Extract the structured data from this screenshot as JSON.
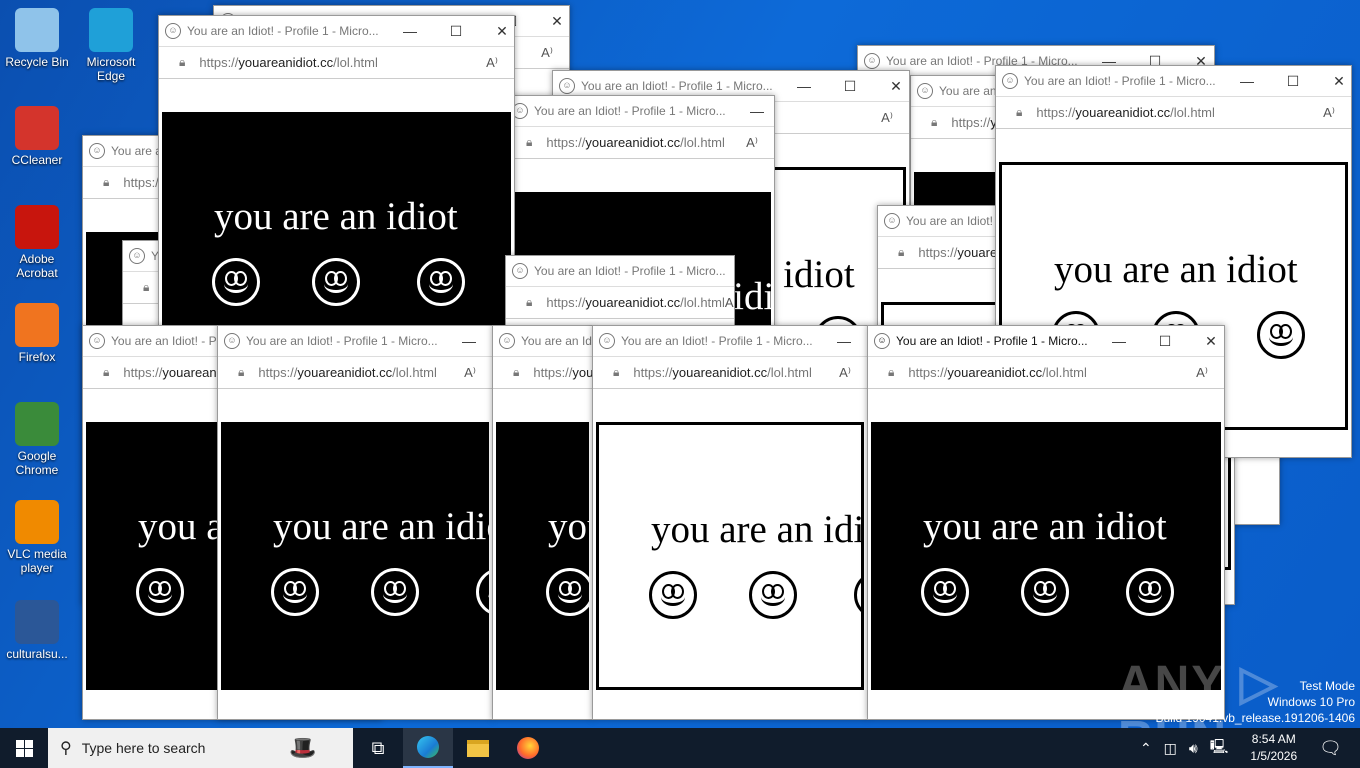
{
  "desktop": {
    "icons": [
      {
        "label": "Recycle Bin",
        "icon": "recycle-bin-icon",
        "color": "#8fc3ea"
      },
      {
        "label": "Microsoft Edge",
        "icon": "edge-icon",
        "color": "#1fa0d8"
      },
      {
        "label": "CCleaner",
        "icon": "ccleaner-icon",
        "color": "#d4342c"
      },
      {
        "label": "Adobe Acrobat",
        "icon": "acrobat-icon",
        "color": "#c8150d"
      },
      {
        "label": "Firefox",
        "icon": "firefox-icon",
        "color": "#f0741f"
      },
      {
        "label": "Google Chrome",
        "icon": "chrome-icon",
        "color": "#3a8b3a"
      },
      {
        "label": "VLC media player",
        "icon": "vlc-icon",
        "color": "#f08a00"
      },
      {
        "label": "culturalsu...",
        "icon": "word-doc-icon",
        "color": "#2b5797"
      }
    ]
  },
  "browser": {
    "title": "You are an Idiot! - Profile 1 - Micro...",
    "url_prefix": "https://",
    "url_domain": "youareanidiot.cc",
    "url_path": "/lol.html",
    "content_text": "you are an idiot",
    "minimize": "—",
    "maximize": "☐",
    "close": "✕",
    "read_aloud": "A⁾"
  },
  "taskbar": {
    "search_placeholder": "Type here to search",
    "time": "8:54 AM",
    "date": "1/5/2026"
  },
  "watermark": {
    "line1": "Test Mode",
    "line2": "Windows 10 Pro",
    "line3": "Build 19041.vb_release.191206-1406",
    "logo": "ANY.RUN"
  }
}
